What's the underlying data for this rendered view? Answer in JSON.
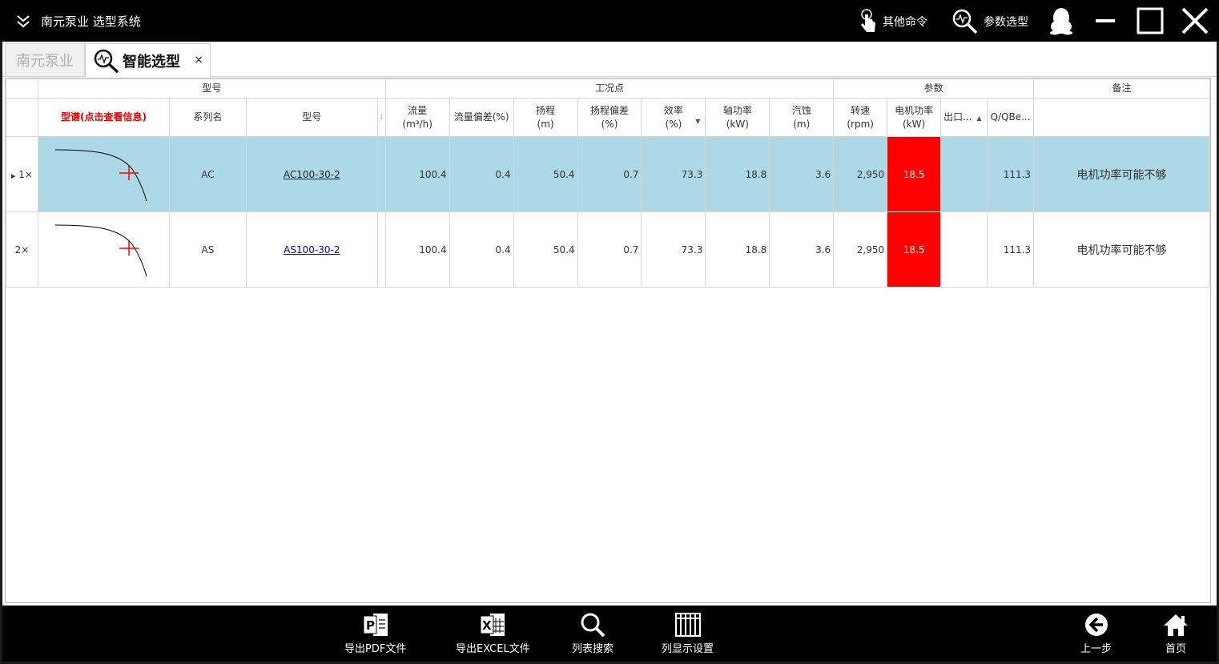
{
  "app": {
    "title": "南元泵业 选型系统",
    "commands": [
      {
        "label": "其他命令",
        "icon": "touch-hand-icon"
      },
      {
        "label": "参数选型",
        "icon": "parameter-search-icon"
      }
    ]
  },
  "tabs": {
    "home_label": "南元泵业",
    "active_label": "智能选型",
    "close_glyph": "×"
  },
  "grid": {
    "bands": {
      "model": "型号",
      "duty": "工况点",
      "params": "参数",
      "remark": "备注"
    },
    "columns": {
      "curve": "型谱(点击查看信息)",
      "series": "系列名",
      "model": "型号",
      "narrow": ":",
      "flow": "流量\n(m³/h)",
      "flow_dev": "流量偏差(%)",
      "head": "扬程\n(m)",
      "head_dev": "扬程偏差\n(%)",
      "eff": "效率\n(%)",
      "shaft_power": "轴功率\n(kW)",
      "npsh": "汽蚀\n(m)",
      "speed": "转速\n(rpm)",
      "motor_power": "电机功率\n(kW)",
      "outlet": "出口...",
      "qqbe": "Q/QBe...",
      "remark": ""
    },
    "rows": [
      {
        "index": "1×",
        "series": "AC",
        "model": "AC100-30-2",
        "flow": "100.4",
        "flow_dev": "0.4",
        "head": "50.4",
        "head_dev": "0.7",
        "eff": "73.3",
        "shaft_power": "18.8",
        "npsh": "3.6",
        "speed": "2,950",
        "motor_power": "18.5",
        "outlet": "",
        "qqbe": "111.3",
        "remark": "电机功率可能不够",
        "selected": true
      },
      {
        "index": "2×",
        "series": "AS",
        "model": "AS100-30-2",
        "flow": "100.4",
        "flow_dev": "0.4",
        "head": "50.4",
        "head_dev": "0.7",
        "eff": "73.3",
        "shaft_power": "18.8",
        "npsh": "3.6",
        "speed": "2,950",
        "motor_power": "18.5",
        "outlet": "",
        "qqbe": "111.3",
        "remark": "电机功率可能不够",
        "selected": false
      }
    ]
  },
  "toolbar": {
    "export_pdf": "导出PDF文件",
    "export_excel": "导出EXCEL文件",
    "list_search": "列表搜索",
    "column_settings": "列显示设置",
    "back": "上一步",
    "home": "首页"
  },
  "colors": {
    "selected_row": "#add8e6",
    "warning_cell": "#ff0000",
    "curve_header": "#e00000",
    "link": "#0000cc"
  }
}
